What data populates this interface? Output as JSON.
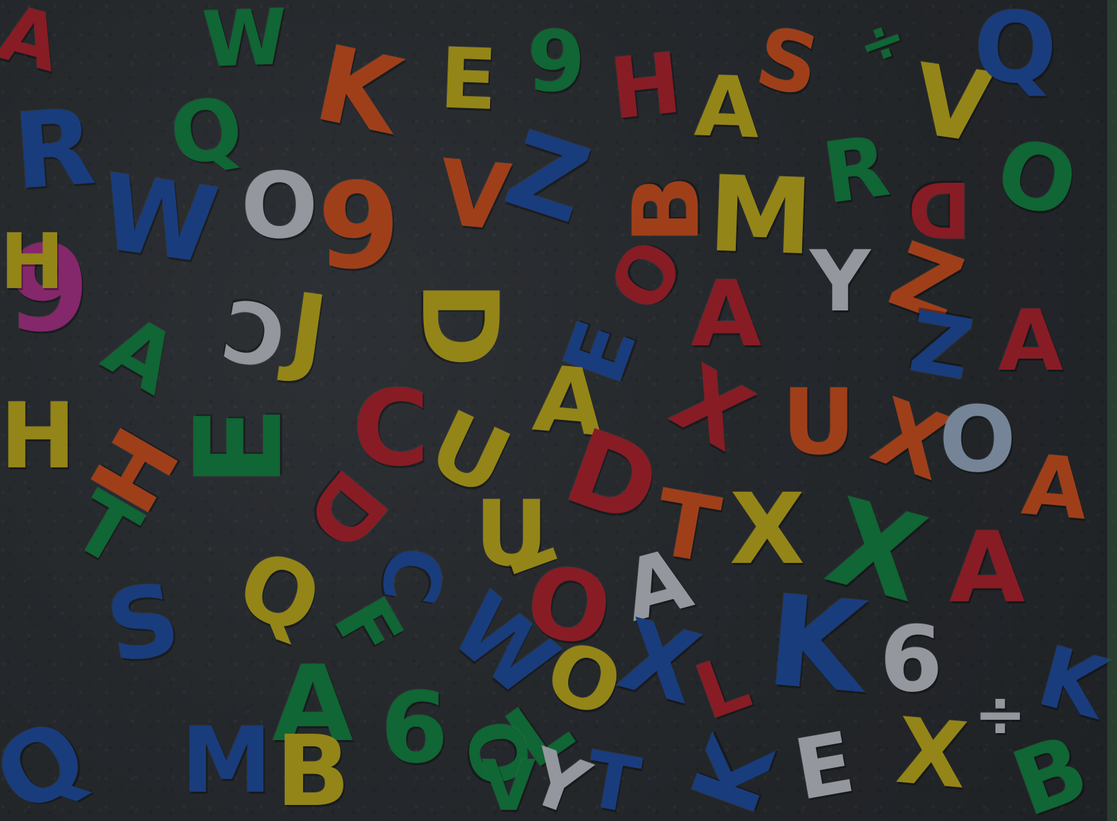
{
  "palette": {
    "blue": "#1f4fa8",
    "green": "#138a43",
    "red": "#b8232f",
    "orange": "#d9541f",
    "yellow": "#c9b51d",
    "white": "#c9cfd6",
    "pink": "#b5338f",
    "lightblue": "#9fb5cc"
  },
  "letters": [
    {
      "ch": "W",
      "color": "green"
    },
    {
      "ch": "K",
      "color": "orange"
    },
    {
      "ch": "E",
      "color": "yellow"
    },
    {
      "ch": "9",
      "color": "green"
    },
    {
      "ch": "H",
      "color": "red"
    },
    {
      "ch": "A",
      "color": "yellow"
    },
    {
      "ch": "S",
      "color": "orange"
    },
    {
      "ch": "÷",
      "color": "green"
    },
    {
      "ch": "V",
      "color": "yellow"
    },
    {
      "ch": "Q",
      "color": "blue"
    },
    {
      "ch": "R",
      "color": "blue"
    },
    {
      "ch": "Q",
      "color": "green"
    },
    {
      "ch": "W",
      "color": "blue"
    },
    {
      "ch": "O",
      "color": "white"
    },
    {
      "ch": "9",
      "color": "orange"
    },
    {
      "ch": "V",
      "color": "orange"
    },
    {
      "ch": "Z",
      "color": "blue"
    },
    {
      "ch": "B",
      "color": "orange"
    },
    {
      "ch": "M",
      "color": "yellow"
    },
    {
      "ch": "R",
      "color": "green"
    },
    {
      "ch": "D",
      "color": "red"
    },
    {
      "ch": "O",
      "color": "green"
    },
    {
      "ch": "9",
      "color": "pink"
    },
    {
      "ch": "C",
      "color": "white"
    },
    {
      "ch": "J",
      "color": "yellow"
    },
    {
      "ch": "D",
      "color": "yellow"
    },
    {
      "ch": "O",
      "color": "red"
    },
    {
      "ch": "Y",
      "color": "white"
    },
    {
      "ch": "Z",
      "color": "orange"
    },
    {
      "ch": "A",
      "color": "red"
    },
    {
      "ch": "A",
      "color": "green"
    },
    {
      "ch": "E",
      "color": "blue"
    },
    {
      "ch": "Z",
      "color": "blue"
    },
    {
      "ch": "A",
      "color": "red"
    },
    {
      "ch": "H",
      "color": "yellow"
    },
    {
      "ch": "E",
      "color": "green"
    },
    {
      "ch": "C",
      "color": "red"
    },
    {
      "ch": "A",
      "color": "yellow"
    },
    {
      "ch": "X",
      "color": "red"
    },
    {
      "ch": "U",
      "color": "orange"
    },
    {
      "ch": "X",
      "color": "orange"
    },
    {
      "ch": "O",
      "color": "lightblue"
    },
    {
      "ch": "H",
      "color": "orange"
    },
    {
      "ch": "U",
      "color": "yellow"
    },
    {
      "ch": "D",
      "color": "red"
    },
    {
      "ch": "D",
      "color": "red"
    },
    {
      "ch": "T",
      "color": "orange"
    },
    {
      "ch": "X",
      "color": "yellow"
    },
    {
      "ch": "A",
      "color": "orange"
    },
    {
      "ch": "T",
      "color": "green"
    },
    {
      "ch": "U",
      "color": "yellow"
    },
    {
      "ch": "I",
      "color": "yellow"
    },
    {
      "ch": "O",
      "color": "red"
    },
    {
      "ch": "A",
      "color": "white"
    },
    {
      "ch": "X",
      "color": "green"
    },
    {
      "ch": "A",
      "color": "red"
    },
    {
      "ch": "Q",
      "color": "yellow"
    },
    {
      "ch": "C",
      "color": "blue"
    },
    {
      "ch": "S",
      "color": "blue"
    },
    {
      "ch": "F",
      "color": "green"
    },
    {
      "ch": "W",
      "color": "blue"
    },
    {
      "ch": "O",
      "color": "yellow"
    },
    {
      "ch": "X",
      "color": "blue"
    },
    {
      "ch": "L",
      "color": "red"
    },
    {
      "ch": "K",
      "color": "blue"
    },
    {
      "ch": "6",
      "color": "white"
    },
    {
      "ch": "A",
      "color": "green"
    },
    {
      "ch": "6",
      "color": "green"
    },
    {
      "ch": "L",
      "color": "green"
    },
    {
      "ch": "O",
      "color": "green"
    },
    {
      "ch": "M",
      "color": "blue"
    },
    {
      "ch": "B",
      "color": "yellow"
    },
    {
      "ch": "E",
      "color": "white"
    },
    {
      "ch": "X",
      "color": "yellow"
    },
    {
      "ch": "÷",
      "color": "white"
    },
    {
      "ch": "K",
      "color": "blue"
    },
    {
      "ch": "B",
      "color": "green"
    },
    {
      "ch": "Q",
      "color": "blue"
    },
    {
      "ch": "K",
      "color": "blue"
    },
    {
      "ch": "Y",
      "color": "white"
    },
    {
      "ch": "T",
      "color": "blue"
    },
    {
      "ch": "V",
      "color": "green"
    },
    {
      "ch": "A",
      "color": "red"
    },
    {
      "ch": "H",
      "color": "yellow"
    }
  ]
}
